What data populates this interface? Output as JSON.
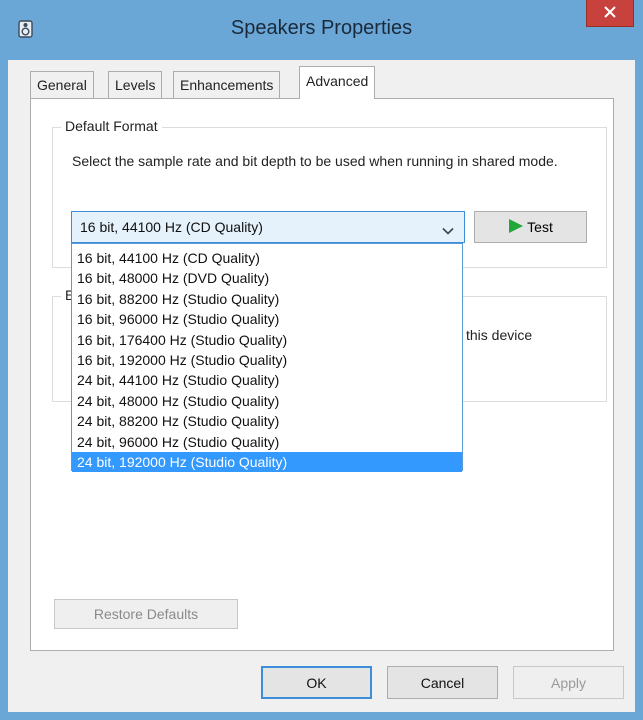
{
  "window": {
    "title": "Speakers Properties",
    "icon": "speaker-icon",
    "close_icon": "close-icon"
  },
  "tabs": [
    {
      "label": "General",
      "active": false
    },
    {
      "label": "Levels",
      "active": false
    },
    {
      "label": "Enhancements",
      "active": false
    },
    {
      "label": "Advanced",
      "active": true
    }
  ],
  "default_format": {
    "group_label": "Default Format",
    "description": "Select the sample rate and bit depth to be used when running in shared mode.",
    "selected_value": "16 bit, 44100 Hz (CD Quality)",
    "test_label": "Test",
    "options": [
      "16 bit, 44100 Hz (CD Quality)",
      "16 bit, 48000 Hz (DVD Quality)",
      "16 bit, 88200 Hz (Studio Quality)",
      "16 bit, 96000 Hz (Studio Quality)",
      "16 bit, 176400 Hz (Studio Quality)",
      "16 bit, 192000 Hz (Studio Quality)",
      "24 bit, 44100 Hz (Studio Quality)",
      "24 bit, 48000 Hz (Studio Quality)",
      "24 bit, 88200 Hz (Studio Quality)",
      "24 bit, 96000 Hz (Studio Quality)",
      "24 bit, 192000 Hz (Studio Quality)"
    ],
    "highlighted_option": "24 bit, 192000 Hz (Studio Quality)"
  },
  "exclusive_mode": {
    "group_label_visible": "E",
    "visible_text": "this device"
  },
  "buttons": {
    "restore_defaults": "Restore Defaults",
    "ok": "OK",
    "cancel": "Cancel",
    "apply": "Apply"
  },
  "colors": {
    "frame": "#6aa6d6",
    "close": "#c7423c",
    "selection": "#3399ff",
    "accent": "#3c8ed9",
    "test_play": "#22a83a"
  }
}
